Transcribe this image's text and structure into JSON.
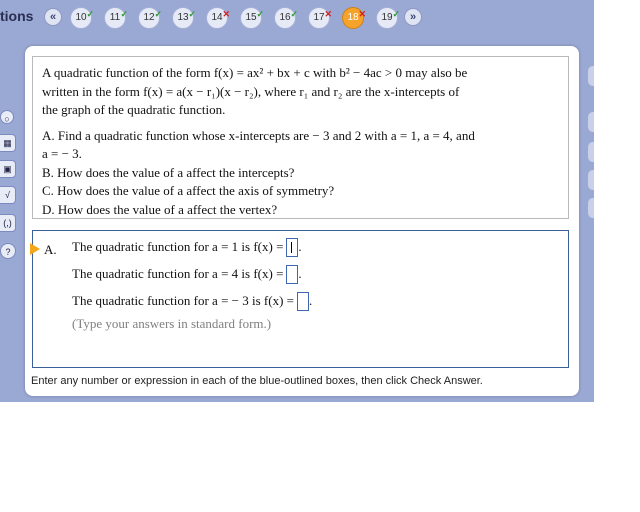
{
  "nav": {
    "label": "tions",
    "prev_icon": "double-chevron-left",
    "next_icon": "double-chevron-right",
    "questions": [
      {
        "num": "10",
        "status": "correct"
      },
      {
        "num": "11",
        "status": "correct"
      },
      {
        "num": "12",
        "status": "correct"
      },
      {
        "num": "13",
        "status": "correct"
      },
      {
        "num": "14",
        "status": "incorrect"
      },
      {
        "num": "15",
        "status": "correct"
      },
      {
        "num": "16",
        "status": "correct"
      },
      {
        "num": "17",
        "status": "incorrect"
      },
      {
        "num": "18",
        "status": "incorrect",
        "current": true
      },
      {
        "num": "19",
        "status": "correct"
      }
    ]
  },
  "question": {
    "intro_1": "A quadratic function of the form f(x) = ax² + bx + c with b² − 4ac > 0 may also be",
    "intro_2": "written in the form f(x) = a(x − r₁)(x − r₂), where r₁ and r₂ are the x-intercepts of",
    "intro_3": "the graph of the quadratic function.",
    "part_a_1": "A.  Find a quadratic function whose x-intercepts are  − 3 and 2 with a = 1,  a = 4,  and",
    "part_a_2": "a = − 3.",
    "part_b": "B.  How does the value of a affect the intercepts?",
    "part_c": "C.  How does the value of a affect the axis of symmetry?",
    "part_d": "D.  How does the value of a affect the vertex?"
  },
  "answer": {
    "letter": "A.",
    "row1": "The quadratic function for a = 1 is f(x) =",
    "row2": "The quadratic function for a = 4 is f(x) =",
    "row3": "The quadratic function for a = − 3 is f(x) =",
    "row_end": ".",
    "hint": "(Type your answers in standard form.)"
  },
  "instructions": "Enter any number or expression in each of the blue-outlined boxes, then click Check Answer.",
  "colors": {
    "background": "#9aa8d4",
    "current_question": "#f5a32b",
    "answer_box": "#3f67b0",
    "correct": "#2f9a2f",
    "incorrect": "#d02020"
  }
}
